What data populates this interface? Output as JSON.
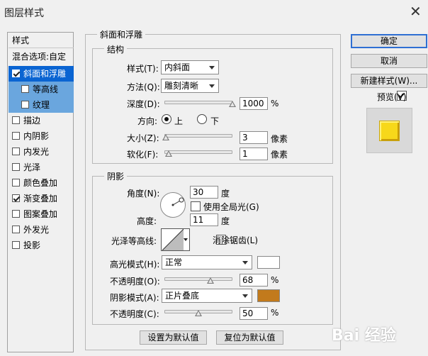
{
  "window": {
    "title": "图层样式",
    "close_glyph": "✕"
  },
  "styles_list": {
    "header": "样式",
    "blend_options": "混合选项:自定",
    "items": [
      {
        "label": "斜面和浮雕",
        "checked": true
      },
      {
        "label": "等高线",
        "checked": false
      },
      {
        "label": "纹理",
        "checked": false
      },
      {
        "label": "描边",
        "checked": false
      },
      {
        "label": "内阴影",
        "checked": false
      },
      {
        "label": "内发光",
        "checked": false
      },
      {
        "label": "光泽",
        "checked": false
      },
      {
        "label": "颜色叠加",
        "checked": false
      },
      {
        "label": "渐变叠加",
        "checked": true
      },
      {
        "label": "图案叠加",
        "checked": false
      },
      {
        "label": "外发光",
        "checked": false
      },
      {
        "label": "投影",
        "checked": false
      }
    ]
  },
  "bevel": {
    "section_title": "斜面和浮雕",
    "structure": {
      "title": "结构",
      "style_label": "样式(T):",
      "style_value": "内斜面",
      "technique_label": "方法(Q):",
      "technique_value": "雕刻清晰",
      "depth_label": "深度(D):",
      "depth_value": "1000",
      "depth_unit": "%",
      "depth_level": 1.0,
      "direction_label": "方向:",
      "direction_up": "上",
      "direction_down": "下",
      "direction_selected": "上",
      "size_label": "大小(Z):",
      "size_value": "3",
      "size_unit": "像素",
      "size_level": 0.02,
      "soften_label": "软化(F):",
      "soften_value": "1",
      "soften_unit": "像素",
      "soften_level": 0.06
    },
    "shading": {
      "title": "阴影",
      "angle_label": "角度(N):",
      "angle_value": "30",
      "angle_unit": "度",
      "global_light_label": "使用全局光(G)",
      "global_light_checked": false,
      "altitude_label": "高度:",
      "altitude_value": "11",
      "altitude_unit": "度",
      "gloss_label": "光泽等高线:",
      "antialias_label": "消除锯齿(L)",
      "antialias_checked": false,
      "highlight_label": "高光模式(H):",
      "highlight_mode": "正常",
      "highlight_color": "#ffffff",
      "opacity1_label": "不透明度(O):",
      "opacity1_value": "68",
      "opacity1_unit": "%",
      "opacity1_level": 0.68,
      "shadow_label": "阴影模式(A):",
      "shadow_mode": "正片叠底",
      "shadow_color": "#c27a1c",
      "opacity2_label": "不透明度(C):",
      "opacity2_value": "50",
      "opacity2_unit": "%",
      "opacity2_level": 0.5
    },
    "set_default": "设置为默认值",
    "reset_default": "复位为默认值"
  },
  "right": {
    "ok": "确定",
    "cancel": "取消",
    "new_style": "新建样式(W)...",
    "preview_label": "预览(V)",
    "preview_checked": true,
    "preview_color": "#f7d81a"
  },
  "watermark": "Bai 经验"
}
